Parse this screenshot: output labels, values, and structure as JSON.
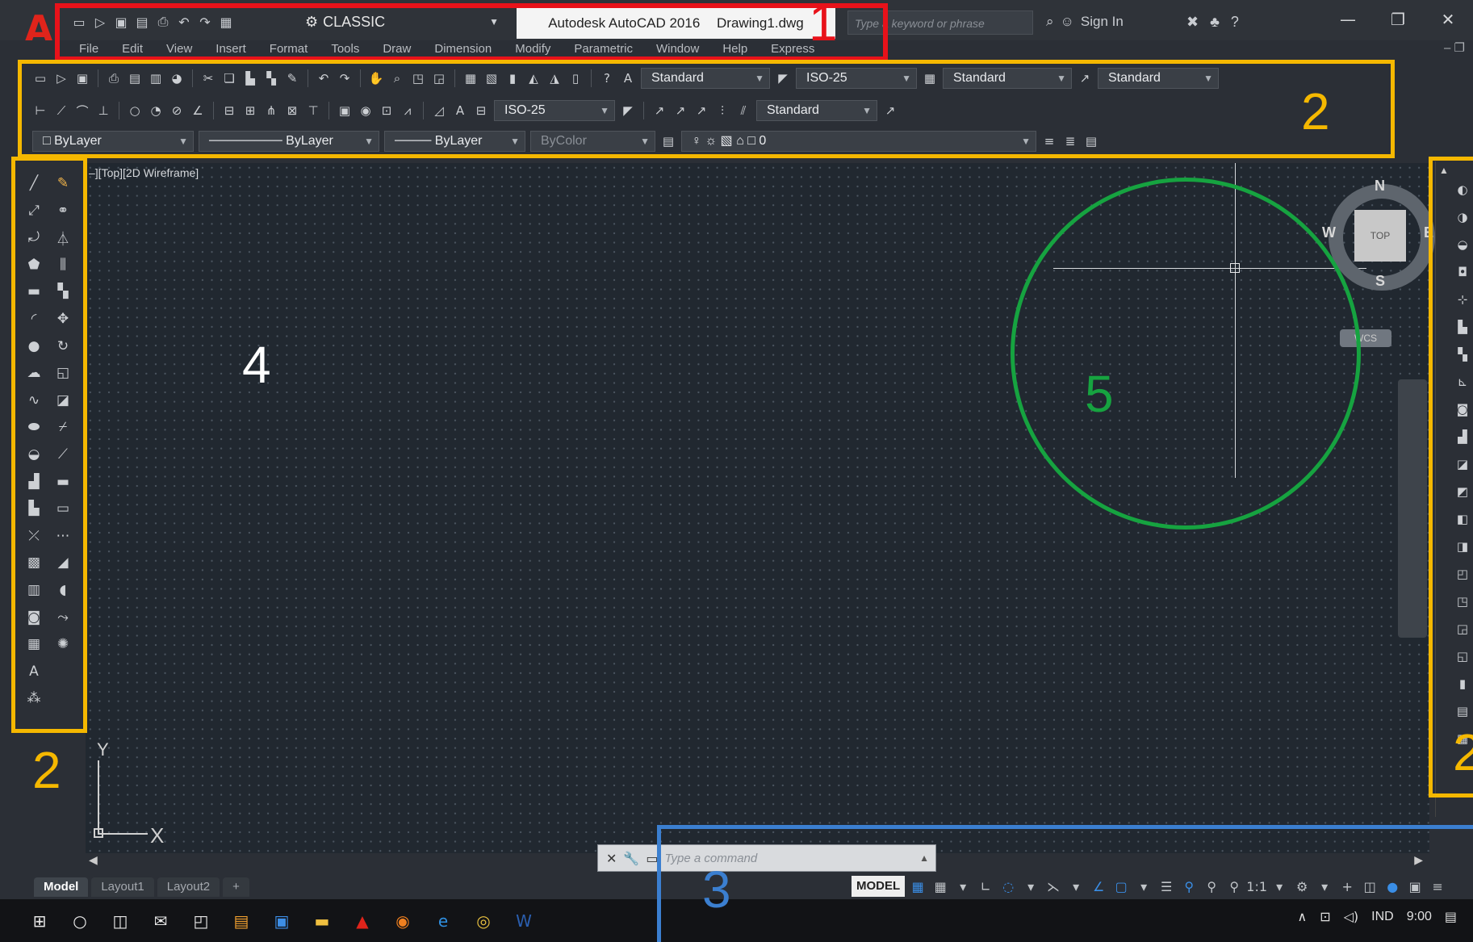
{
  "window": {
    "workspace": "CLASSIC",
    "title_app": "Autodesk AutoCAD 2016",
    "title_file": "Drawing1.dwg",
    "search_placeholder": "Type a keyword or phrase",
    "sign_in": "Sign In"
  },
  "menu": [
    "File",
    "Edit",
    "View",
    "Insert",
    "Format",
    "Tools",
    "Draw",
    "Dimension",
    "Modify",
    "Parametric",
    "Window",
    "Help",
    "Express"
  ],
  "toolbars": {
    "text_style": "Standard",
    "dim_style": "ISO-25",
    "table_style": "Standard",
    "multileader_style": "Standard",
    "dim_style_2": "ISO-25",
    "multileader_style_2": "Standard",
    "layer_color": "ByLayer",
    "linetype": "ByLayer",
    "lineweight": "ByLayer",
    "plot_style": "ByColor",
    "current_layer": "0"
  },
  "canvas": {
    "view_label": "–][Top][2D Wireframe]",
    "viewcube_face": "TOP",
    "compass": {
      "n": "N",
      "s": "S",
      "e": "E",
      "w": "W"
    },
    "wcs": "WCS",
    "ucs_x": "X",
    "ucs_y": "Y"
  },
  "command_line": {
    "placeholder": "Type a command"
  },
  "layout_tabs": [
    "Model",
    "Layout1",
    "Layout2",
    "+"
  ],
  "status": {
    "model": "MODEL",
    "scale": "1:1"
  },
  "taskbar": {
    "lang": "IND",
    "time": "9:00"
  },
  "annotations": {
    "label_1": "1",
    "label_2": "2",
    "label_3": "3",
    "label_4": "4",
    "label_5": "5",
    "colors": {
      "1": "#e8121a",
      "2": "#f5b800",
      "3": "#3b7fd0",
      "4": "#ffffff",
      "5": "#16a340"
    }
  },
  "icons": {
    "quick_access": [
      "new-icon",
      "open-icon",
      "save-icon",
      "save-as-icon",
      "print-icon",
      "undo-icon",
      "redo-icon"
    ],
    "draw_palette": [
      "line-icon",
      "construction-line-icon",
      "polyline-icon",
      "polygon-icon",
      "rectangle-icon",
      "arc-icon",
      "circle-icon",
      "revision-cloud-icon",
      "spline-icon",
      "ellipse-icon",
      "ellipse-arc-icon",
      "insert-block-icon",
      "make-block-icon",
      "point-icon",
      "hatch-icon",
      "gradient-icon",
      "region-icon",
      "table-icon",
      "multiline-text-icon",
      "add-selected-icon"
    ],
    "modify_palette": [
      "erase-icon",
      "copy-icon",
      "mirror-icon",
      "offset-icon",
      "array-icon",
      "move-icon",
      "rotate-icon",
      "scale-icon",
      "stretch-icon",
      "trim-icon",
      "extend-icon",
      "break-at-point-icon",
      "break-icon",
      "join-icon",
      "chamfer-icon",
      "fillet-icon",
      "blend-curves-icon",
      "explode-icon"
    ]
  }
}
